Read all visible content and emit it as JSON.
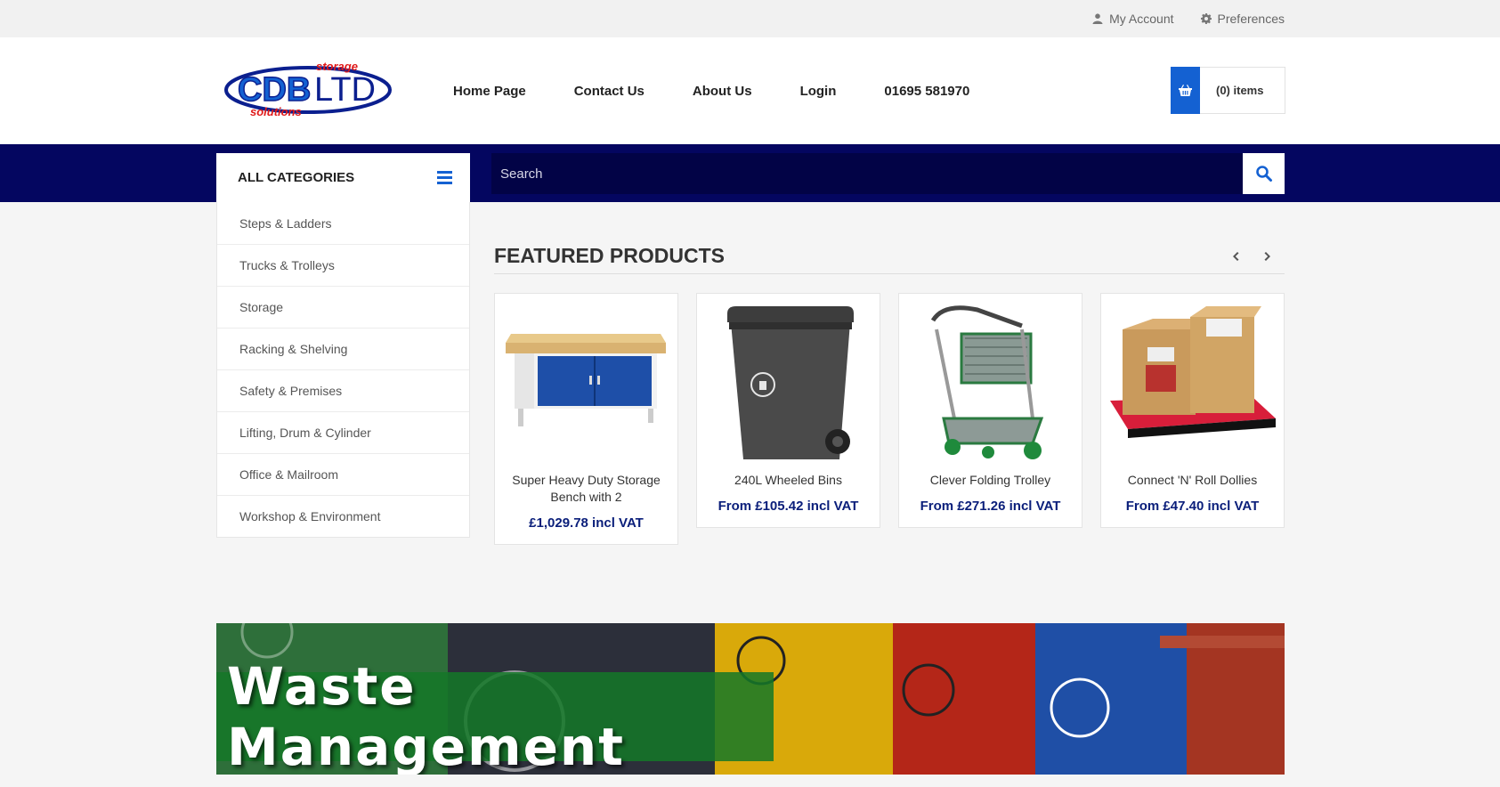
{
  "topbar": {
    "account_label": "My Account",
    "preferences_label": "Preferences"
  },
  "logo": {
    "top_text": "storage",
    "main_text_a": "CDB",
    "main_text_b": "LTD",
    "bottom_text": "solutions"
  },
  "nav": {
    "items": [
      "Home Page",
      "Contact Us",
      "About Us",
      "Login",
      "01695 581970"
    ]
  },
  "cart": {
    "label": "(0) items"
  },
  "categories": {
    "heading": "ALL CATEGORIES",
    "items": [
      "Steps & Ladders",
      "Trucks & Trolleys",
      "Storage",
      "Racking & Shelving",
      "Safety & Premises",
      "Lifting, Drum & Cylinder",
      "Office & Mailroom",
      "Workshop & Environment"
    ]
  },
  "search": {
    "placeholder": "Search"
  },
  "featured": {
    "title": "FEATURED PRODUCTS",
    "products": [
      {
        "name": "Super Heavy Duty Storage Bench with 2",
        "price": "£1,029.78 incl VAT"
      },
      {
        "name": "240L Wheeled Bins",
        "price": "From £105.42 incl VAT"
      },
      {
        "name": "Clever Folding Trolley",
        "price": "From £271.26 incl VAT"
      },
      {
        "name": "Connect 'N' Roll Dollies",
        "price": "From £47.40 incl VAT"
      }
    ]
  },
  "banner": {
    "title": "Waste Management"
  },
  "colors": {
    "brand_blue": "#1461d2",
    "band_navy": "#040660",
    "price_blue": "#0a1e7a"
  }
}
